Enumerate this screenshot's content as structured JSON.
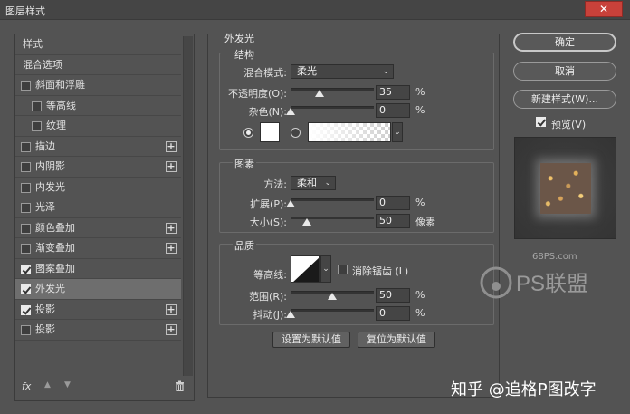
{
  "window": {
    "title": "图层样式",
    "close_glyph": "✕"
  },
  "left_panel": {
    "items": [
      {
        "label": "样式",
        "checkbox": false,
        "checked": false,
        "plus": false,
        "indent": 0,
        "selected": false
      },
      {
        "label": "混合选项",
        "checkbox": false,
        "checked": false,
        "plus": false,
        "indent": 0,
        "selected": false
      },
      {
        "label": "斜面和浮雕",
        "checkbox": true,
        "checked": false,
        "plus": false,
        "indent": 0,
        "selected": false
      },
      {
        "label": "等高线",
        "checkbox": true,
        "checked": false,
        "plus": false,
        "indent": 1,
        "selected": false
      },
      {
        "label": "纹理",
        "checkbox": true,
        "checked": false,
        "plus": false,
        "indent": 1,
        "selected": false
      },
      {
        "label": "描边",
        "checkbox": true,
        "checked": false,
        "plus": true,
        "indent": 0,
        "selected": false
      },
      {
        "label": "内阴影",
        "checkbox": true,
        "checked": false,
        "plus": true,
        "indent": 0,
        "selected": false
      },
      {
        "label": "内发光",
        "checkbox": true,
        "checked": false,
        "plus": false,
        "indent": 0,
        "selected": false
      },
      {
        "label": "光泽",
        "checkbox": true,
        "checked": false,
        "plus": false,
        "indent": 0,
        "selected": false
      },
      {
        "label": "颜色叠加",
        "checkbox": true,
        "checked": false,
        "plus": true,
        "indent": 0,
        "selected": false
      },
      {
        "label": "渐变叠加",
        "checkbox": true,
        "checked": false,
        "plus": true,
        "indent": 0,
        "selected": false
      },
      {
        "label": "图案叠加",
        "checkbox": true,
        "checked": true,
        "plus": false,
        "indent": 0,
        "selected": false
      },
      {
        "label": "外发光",
        "checkbox": true,
        "checked": true,
        "plus": false,
        "indent": 0,
        "selected": true
      },
      {
        "label": "投影",
        "checkbox": true,
        "checked": true,
        "plus": true,
        "indent": 0,
        "selected": false
      },
      {
        "label": "投影",
        "checkbox": true,
        "checked": false,
        "plus": true,
        "indent": 0,
        "selected": false
      }
    ],
    "plus_glyph": "+",
    "bottom": {
      "fx": "fx",
      "up": "▲",
      "down": "▼"
    }
  },
  "outer_glow": {
    "section_title": "外发光",
    "structure": {
      "title": "结构",
      "blend_mode_label": "混合模式:",
      "blend_mode_value": "柔光",
      "opacity_label": "不透明度(O):",
      "opacity_value": "35",
      "opacity_fraction": 0.35,
      "noise_label": "杂色(N):",
      "noise_value": "0",
      "noise_fraction": 0.0,
      "percent": "%"
    },
    "elements": {
      "title": "图素",
      "technique_label": "方法:",
      "technique_value": "柔和",
      "spread_label": "扩展(P):",
      "spread_value": "0",
      "spread_fraction": 0.0,
      "size_label": "大小(S):",
      "size_value": "50",
      "size_fraction": 0.2,
      "percent": "%",
      "size_unit": "像素"
    },
    "quality": {
      "title": "品质",
      "contour_label": "等高线:",
      "antialias_label": "消除锯齿 (L)",
      "range_label": "范围(R):",
      "range_value": "50",
      "range_fraction": 0.5,
      "jitter_label": "抖动(J):",
      "jitter_value": "0",
      "jitter_fraction": 0.0,
      "percent": "%"
    },
    "buttons": {
      "set_default": "设置为默认值",
      "reset_default": "复位为默认值"
    }
  },
  "right_panel": {
    "ok": "确定",
    "cancel": "取消",
    "new_style": "新建样式(W)...",
    "preview_label": "预览(V)",
    "preview_checked": true
  },
  "watermarks": {
    "site": "68PS.com",
    "logo_text": "PS联盟",
    "bottom": "知乎 @追格P图改字"
  },
  "colors": {
    "bg": "#535353",
    "selected": "#6e6e6e",
    "close": "#c8413a"
  }
}
